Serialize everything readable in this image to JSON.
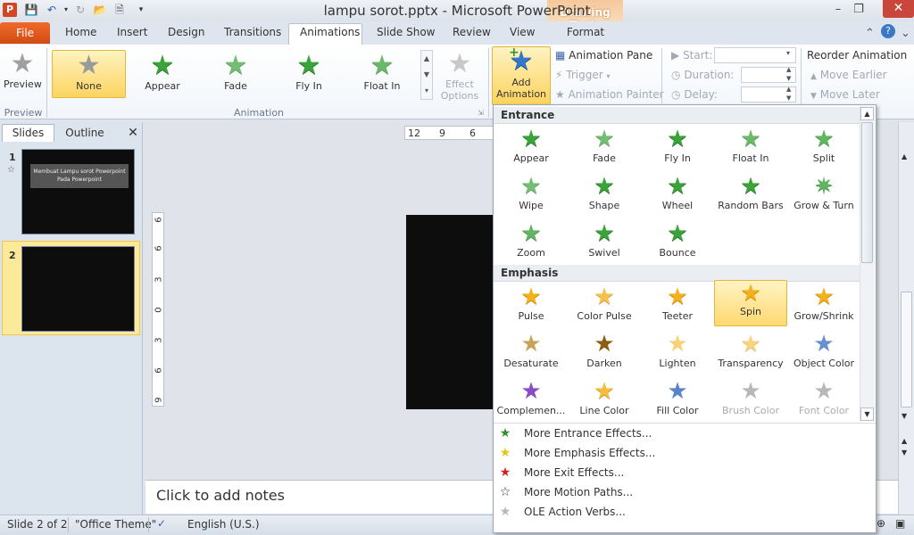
{
  "window": {
    "title": "lampu sorot.pptx  -  Microsoft PowerPoint",
    "contextual_tab_group": "Drawing Tools"
  },
  "tabs": {
    "file": "File",
    "items": [
      "Home",
      "Insert",
      "Design",
      "Transitions",
      "Animations",
      "Slide Show",
      "Review",
      "View"
    ],
    "active": "Animations",
    "format": "Format"
  },
  "ribbon": {
    "preview_group": {
      "button": "Preview",
      "label": "Preview"
    },
    "animation_group": {
      "label": "Animation",
      "effects": [
        "None",
        "Appear",
        "Fade",
        "Fly In",
        "Float In"
      ],
      "selected": "None",
      "effect_options": [
        "Effect",
        "Options"
      ]
    },
    "add_animation": [
      "Add",
      "Animation"
    ],
    "advanced": {
      "animation_pane": "Animation Pane",
      "trigger": "Trigger",
      "animation_painter": "Animation Painter"
    },
    "timing": {
      "start": "Start:",
      "duration": "Duration:",
      "delay": "Delay:",
      "reorder": "Reorder Animation",
      "move_earlier": "Move Earlier",
      "move_later": "Move Later"
    }
  },
  "left_panel": {
    "tab_slides": "Slides",
    "tab_outline": "Outline",
    "slide1_number": "1",
    "slide2_number": "2",
    "slide1_title_line1": "Membuat Lampu sorot Powerpoint",
    "slide1_title_line2": "Pada  Powerpoint"
  },
  "rulers": {
    "horizontal": [
      "12",
      "9",
      "6"
    ],
    "vertical": [
      "6",
      "6",
      "3",
      "0",
      "3",
      "6",
      "9"
    ]
  },
  "notes_placeholder": "Click to add notes",
  "status": {
    "slide_info": "Slide 2 of 2",
    "theme": "\"Office Theme\"",
    "language": "English (U.S.)"
  },
  "gallery": {
    "entrance_header": "Entrance",
    "entrance": [
      "Appear",
      "Fade",
      "Fly In",
      "Float In",
      "Split",
      "Wipe",
      "Shape",
      "Wheel",
      "Random Bars",
      "Grow & Turn",
      "Zoom",
      "Swivel",
      "Bounce"
    ],
    "emphasis_header": "Emphasis",
    "emphasis": [
      "Pulse",
      "Color Pulse",
      "Teeter",
      "Spin",
      "Grow/Shrink",
      "Desaturate",
      "Darken",
      "Lighten",
      "Transparency",
      "Object Color",
      "Complemen...",
      "Line Color",
      "Fill Color",
      "Brush Color",
      "Font Color"
    ],
    "emphasis_selected": "Spin",
    "emphasis_disabled": [
      "Brush Color",
      "Font Color"
    ],
    "more": [
      "More Entrance Effects...",
      "More Emphasis Effects...",
      "More Exit Effects...",
      "More Motion Paths...",
      "OLE Action Verbs..."
    ]
  },
  "colors": {
    "file_tab": "#d24b12",
    "selected_gold": "#fdd462",
    "close_red": "#c9463d",
    "entrance_green": "#3aa33a",
    "emphasis_gold": "#f3b21b"
  }
}
